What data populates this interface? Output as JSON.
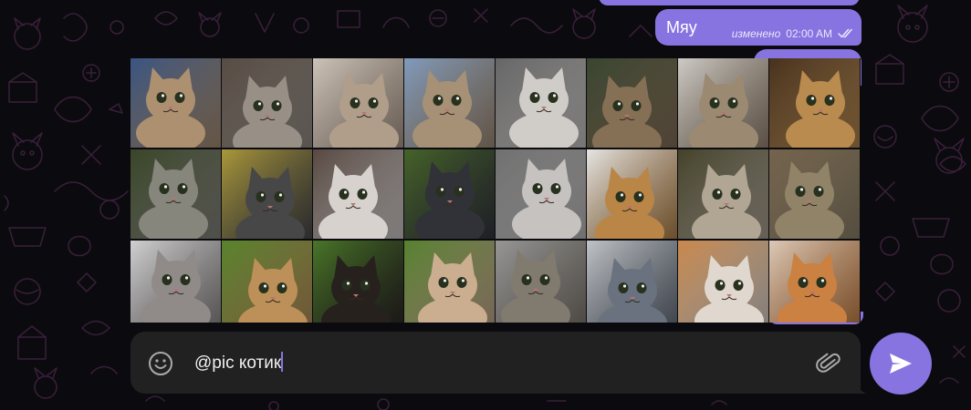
{
  "chat": {
    "messages": [
      {
        "text": "Мяу",
        "status": "изменено",
        "time": "02:00 AM",
        "read_icon": "double-check-icon"
      }
    ]
  },
  "inline_results": {
    "bot": "@pic",
    "query": "котик",
    "count": 24,
    "items": [
      {
        "icon": "cat-photo",
        "palette": [
          "#3d5a8a",
          "#b89a78"
        ]
      },
      {
        "icon": "cat-photo",
        "palette": [
          "#5d5148",
          "#a29a90"
        ]
      },
      {
        "icon": "cat-photo",
        "palette": [
          "#d9cfc4",
          "#bca894"
        ]
      },
      {
        "icon": "cat-photo",
        "palette": [
          "#88a4c8",
          "#b19a7e"
        ]
      },
      {
        "icon": "cat-photo",
        "palette": [
          "#6c6c6c",
          "#dedad6"
        ]
      },
      {
        "icon": "cat-photo",
        "palette": [
          "#3c4a34",
          "#8f785b"
        ]
      },
      {
        "icon": "cat-photo",
        "palette": [
          "#dad7d2",
          "#a6927a"
        ]
      },
      {
        "icon": "cat-photo",
        "palette": [
          "#4c3520",
          "#c69454"
        ]
      },
      {
        "icon": "cat-photo",
        "palette": [
          "#3d4a2a",
          "#8f8f84"
        ]
      },
      {
        "icon": "cat-photo",
        "palette": [
          "#b6a23e",
          "#4c4c4c"
        ]
      },
      {
        "icon": "cat-photo",
        "palette": [
          "#5d4c44",
          "#e6e0dc"
        ]
      },
      {
        "icon": "cat-photo",
        "palette": [
          "#4a6a2c",
          "#34363c"
        ]
      },
      {
        "icon": "cat-photo",
        "palette": [
          "#787878",
          "#d2cfcc"
        ]
      },
      {
        "icon": "cat-photo",
        "palette": [
          "#f4f4f2",
          "#c58f4c"
        ]
      },
      {
        "icon": "cat-photo",
        "palette": [
          "#48462d",
          "#bbb19d"
        ]
      },
      {
        "icon": "cat-photo",
        "palette": [
          "#7c6a52",
          "#9a8c6e"
        ]
      },
      {
        "icon": "cat-photo",
        "palette": [
          "#dedede",
          "#9a9492"
        ]
      },
      {
        "icon": "cat-photo",
        "palette": [
          "#5d8c30",
          "#c89a5e"
        ]
      },
      {
        "icon": "cat-photo",
        "palette": [
          "#4e7e2c",
          "#2a2420"
        ]
      },
      {
        "icon": "cat-photo",
        "palette": [
          "#5b8a32",
          "#d8b898"
        ]
      },
      {
        "icon": "cat-photo",
        "palette": [
          "#a0a0a0",
          "#8a8276"
        ]
      },
      {
        "icon": "cat-photo",
        "palette": [
          "#cdd0d4",
          "#707a86"
        ]
      },
      {
        "icon": "cat-photo",
        "palette": [
          "#d69050",
          "#eee6dc"
        ]
      },
      {
        "icon": "cat-photo",
        "palette": [
          "#ead6c4",
          "#d88a46"
        ]
      }
    ]
  },
  "composer": {
    "value": "@pic котик",
    "emoji_icon": "smile-icon",
    "attach_icon": "paperclip-icon",
    "send_icon": "send-icon"
  },
  "colors": {
    "accent": "#8774e1",
    "background": "#0b0b0f",
    "composer_bg": "#212121",
    "doodle": "#3a1f3a"
  }
}
